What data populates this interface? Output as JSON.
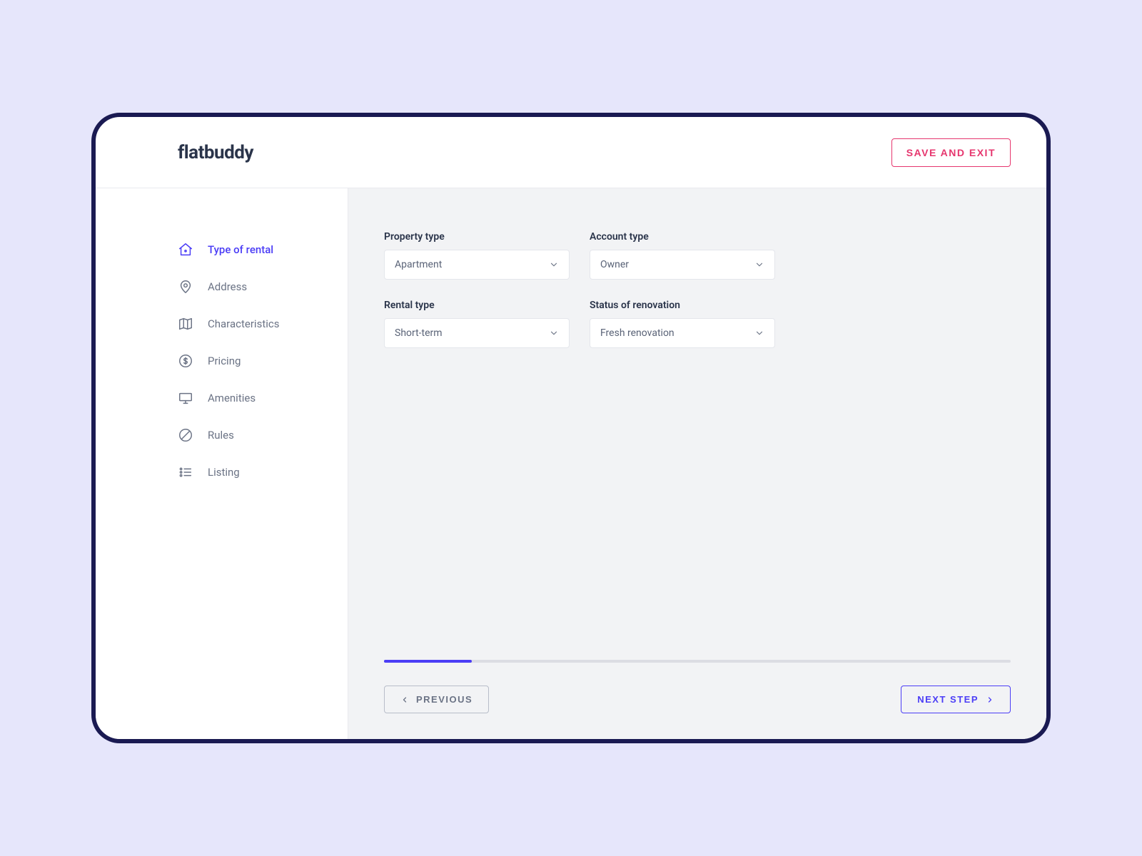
{
  "header": {
    "logo": "flatbuddy",
    "save_exit": "SAVE AND EXIT"
  },
  "sidebar": {
    "items": [
      {
        "label": "Type of rental",
        "active": true
      },
      {
        "label": "Address"
      },
      {
        "label": "Characteristics"
      },
      {
        "label": "Pricing"
      },
      {
        "label": "Amenities"
      },
      {
        "label": "Rules"
      },
      {
        "label": "Listing"
      }
    ]
  },
  "form": {
    "property_type": {
      "label": "Property type",
      "value": "Apartment"
    },
    "account_type": {
      "label": "Account type",
      "value": "Owner"
    },
    "rental_type": {
      "label": "Rental type",
      "value": "Short-term"
    },
    "renovation_status": {
      "label": "Status of renovation",
      "value": "Fresh renovation"
    }
  },
  "footer": {
    "previous": "PREVIOUS",
    "next": "NEXT STEP",
    "progress_percent": 14
  }
}
